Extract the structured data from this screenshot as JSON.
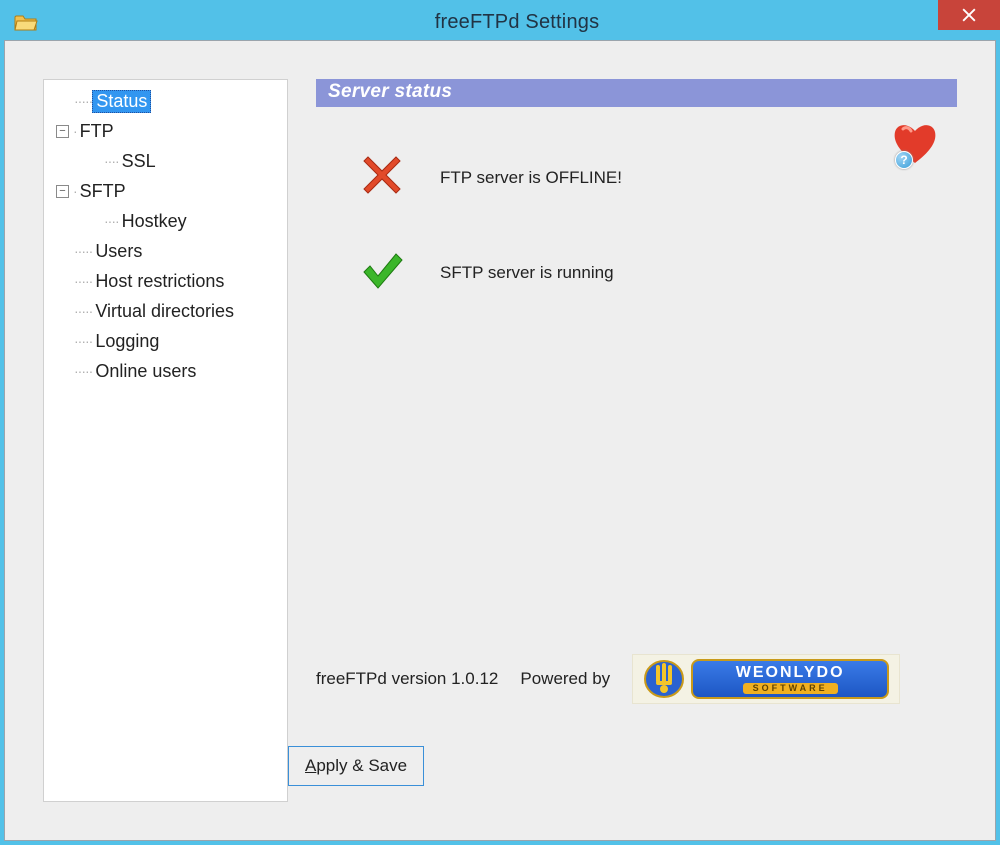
{
  "window": {
    "title": "freeFTPd Settings"
  },
  "tree": {
    "items": [
      {
        "label": "Status",
        "level": 0,
        "selected": true,
        "expander": null
      },
      {
        "label": "FTP",
        "level": 0,
        "selected": false,
        "expander": "-"
      },
      {
        "label": "SSL",
        "level": 1,
        "selected": false,
        "expander": null
      },
      {
        "label": "SFTP",
        "level": 0,
        "selected": false,
        "expander": "-"
      },
      {
        "label": "Hostkey",
        "level": 1,
        "selected": false,
        "expander": null
      },
      {
        "label": "Users",
        "level": 0,
        "selected": false,
        "expander": null
      },
      {
        "label": "Host restrictions",
        "level": 0,
        "selected": false,
        "expander": null
      },
      {
        "label": "Virtual directories",
        "level": 0,
        "selected": false,
        "expander": null
      },
      {
        "label": "Logging",
        "level": 0,
        "selected": false,
        "expander": null
      },
      {
        "label": "Online users",
        "level": 0,
        "selected": false,
        "expander": null
      }
    ]
  },
  "panel": {
    "header": "Server status",
    "ftp_status": "FTP server is OFFLINE!",
    "sftp_status": "SFTP server is running",
    "version_text": "freeFTPd version 1.0.12",
    "powered_by": "Powered by",
    "logo_main": "WEONLYDO",
    "logo_sub": "SOFTWARE"
  },
  "buttons": {
    "apply_save": "Apply & Save"
  },
  "help_badge": "?"
}
